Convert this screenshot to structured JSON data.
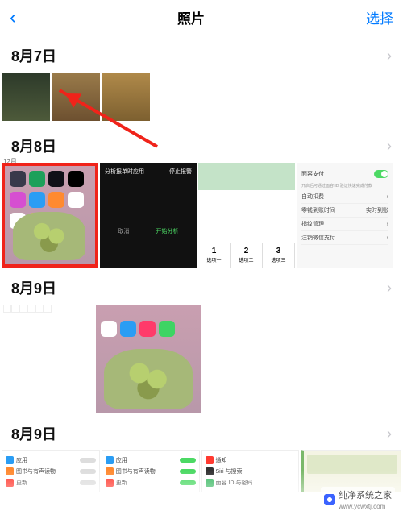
{
  "nav": {
    "title": "照片",
    "select": "选择"
  },
  "sections": [
    {
      "date": "8月7日"
    },
    {
      "date": "8月8日"
    },
    {
      "date": "8月9日"
    },
    {
      "date": "8月9日"
    }
  ],
  "aug7": {
    "badge": "12月"
  },
  "shot_dark": {
    "title": "分析报单时应用",
    "right": "停止报警",
    "b1": "取消",
    "b2": "开始分析"
  },
  "shot_tabs": {
    "t1": "1",
    "t2": "2",
    "t3": "3",
    "s1": "选项一",
    "s2": "选项二",
    "s3": "选项三"
  },
  "shot_settings": {
    "r1": "面容支付",
    "r1sub": "开启后可通过面容 ID 验证快速完成付款",
    "r2": "自动扣费",
    "r3": "零钱到账时间",
    "r3v": "实时到账",
    "r4": "指纹管理",
    "r5": "注销微信支付"
  },
  "list": {
    "a1": "应用",
    "a2": "图书与有声读物",
    "a3": "更新",
    "b1": "应用",
    "b2": "图书与有声读物",
    "b3": "更新",
    "c1": "通知",
    "c2": "Siri 与搜索",
    "c3": "面容 ID 与密码"
  },
  "watermark": {
    "text": "纯净系统之家",
    "url": "www.ycwxtj.com"
  },
  "colors": {
    "accent": "#007aff",
    "highlight": "#f0231a",
    "toggle": "#4cd964"
  }
}
